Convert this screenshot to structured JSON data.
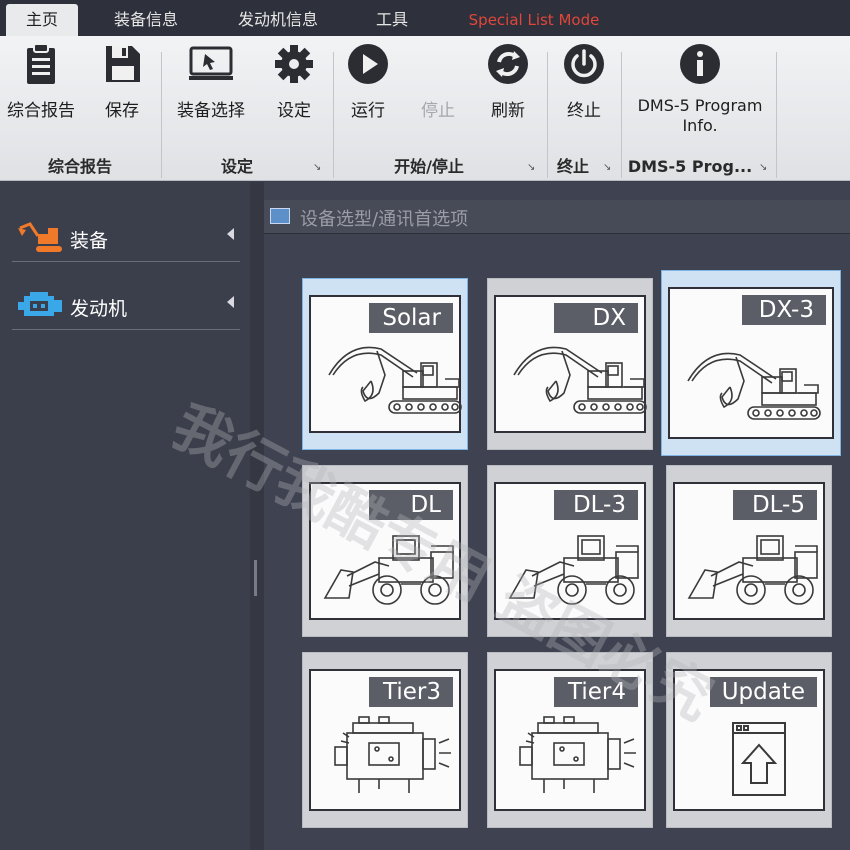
{
  "menu": {
    "tabs": [
      "主页",
      "装备信息",
      "发动机信息",
      "工具"
    ],
    "special": "Special List Mode",
    "active_index": 0
  },
  "ribbon": {
    "buttons": {
      "report": "综合报告",
      "save": "保存",
      "equipment_select": "装备选择",
      "settings": "设定",
      "run": "运行",
      "stop": "停止",
      "refresh": "刷新",
      "terminate": "终止",
      "dms_line1": "DMS-5 Program",
      "dms_line2": "Info."
    },
    "groups": {
      "report": "综合报告",
      "settings": "设定",
      "start_stop": "开始/停止",
      "terminate": "终止",
      "dms": "DMS-5 Prog..."
    }
  },
  "sidebar": {
    "items": [
      {
        "label": "装备",
        "icon": "excavator-icon"
      },
      {
        "label": "发动机",
        "icon": "engine-icon"
      }
    ]
  },
  "panel": {
    "title": "设备选型/通讯首选项"
  },
  "cards": [
    {
      "label": "Solar",
      "icon": "excavator-icon",
      "selected": true
    },
    {
      "label": "DX",
      "icon": "excavator-icon",
      "selected": false
    },
    {
      "label": "DX-3",
      "icon": "excavator-icon",
      "selected": true
    },
    {
      "label": "DL",
      "icon": "wheel-loader-icon",
      "selected": false
    },
    {
      "label": "DL-3",
      "icon": "wheel-loader-icon",
      "selected": false
    },
    {
      "label": "DL-5",
      "icon": "wheel-loader-icon",
      "selected": false
    },
    {
      "label": "Tier3",
      "icon": "engine-icon",
      "selected": false
    },
    {
      "label": "Tier4",
      "icon": "engine-icon",
      "selected": false
    },
    {
      "label": "Update",
      "icon": "update-icon",
      "selected": false
    }
  ],
  "watermark": "我行我酷专用 盗图必究",
  "colors": {
    "ribbon_bg": "#e4e6e9",
    "dark_bg": "#3a3d4a",
    "special_text": "#e0463a",
    "selected_card": "#cfe2f3",
    "card_tag": "#5b5e66"
  }
}
